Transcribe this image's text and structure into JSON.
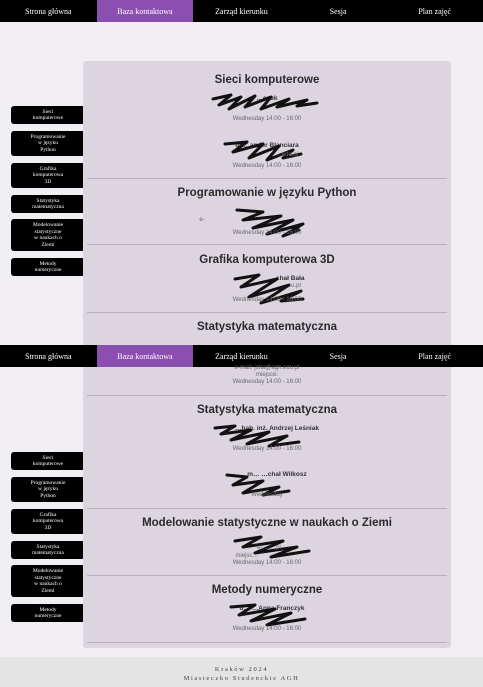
{
  "nav": {
    "items": [
      "Strona główna",
      "Baza kontaktowa",
      "Zarząd kierunku",
      "Sesja",
      "Plan zajęć"
    ],
    "active": "Baza kontaktowa"
  },
  "sidebar": {
    "items": [
      [
        "Sieci",
        "komputerowe"
      ],
      [
        "Programowanie",
        "w języku",
        "Python"
      ],
      [
        "Grafika",
        "komputerowa",
        "3D"
      ],
      [
        "Statystyka",
        "matematyczna"
      ],
      [
        "Modelowanie",
        "statystyczne",
        "w naukach o",
        "Ziemi"
      ],
      [
        "Metody",
        "numeryczne"
      ]
    ]
  },
  "top": {
    "sieci": {
      "title": "Sieci komputerowe",
      "person1": {
        "name": "…czuk",
        "day": "Wednesday",
        "hours": "14:00 - 16:00"
      },
      "person2": {
        "name": "dr …andér Blanciara",
        "email": "…edu.pl",
        "day": "Wednesday",
        "hours": "14:00 - 16:00"
      }
    },
    "python": {
      "title": "Programowanie w języku Python",
      "email_prefix": "e-",
      "day": "Wednesday",
      "hours": "14:00 - 16:00"
    },
    "grafika": {
      "title": "Grafika komputerowa 3D",
      "name": "…chał Bała",
      "email": "…u.pl",
      "day": "Wednesday",
      "hours": "14:00 - 16:00"
    },
    "statystyka_title": "Statystyka matematyczna"
  },
  "bottom": {
    "carryover": {
      "email": "e-mail: jotia@agh.edu.pl",
      "place": "miejsce:",
      "day": "Wednesday",
      "hours": "14:00 - 16:00"
    },
    "statystyka": {
      "title": "Statystyka matematyczna",
      "person1": {
        "name": "…hab. inż. Andrzej Leśniak",
        "day": "Wednesday",
        "hours": "14:00 - 16:00"
      },
      "person2": {
        "name": "m… …chał Wilkosz",
        "day": "Wednesday"
      }
    },
    "modelowanie": {
      "title": "Modelowanie statystyczne w naukach o Ziemi",
      "email": "e-… …pl",
      "place": "miejsc…",
      "day": "Wednesday",
      "hours": "14:00 - 16:00"
    },
    "metody": {
      "title": "Metody numeryczne",
      "name": "d… …Anna Franczyk",
      "day": "Wednesday",
      "hours": "14:00 - 16:00"
    }
  },
  "footer": {
    "line1": "Kraków 2024",
    "line2": "Miasteczko Studenckie AGH"
  },
  "colors": {
    "nav_bg": "#000000",
    "nav_active": "#8a4fb0",
    "card_bg": "#dcd5df",
    "page_bg": "#f1eff4",
    "redaction": "#111111"
  }
}
